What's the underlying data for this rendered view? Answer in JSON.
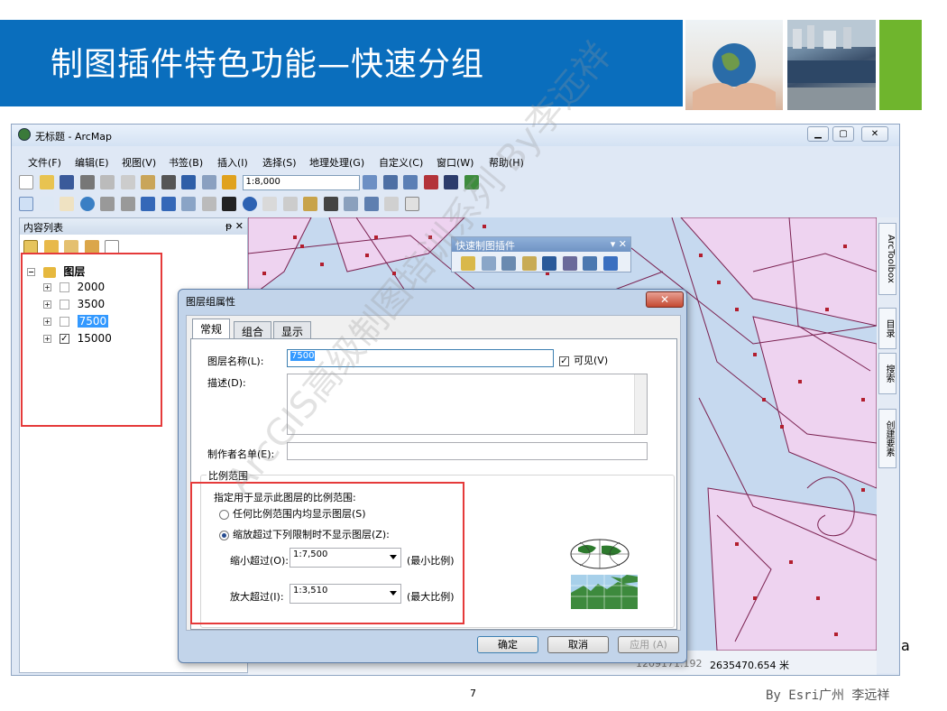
{
  "slide": {
    "title": "制图插件特色功能—快速分组",
    "page_number": "7",
    "footer": "By Esri广州 李远祥",
    "stray_char": "a",
    "watermark": "ArcGIS高级制图培训系列 By李远祥"
  },
  "colors": {
    "header_blue": "#0a6ebd",
    "accent_green": "#6fb52d",
    "highlight_red": "#e53a3a"
  },
  "window": {
    "title": "无标题 - ArcMap",
    "menus": [
      "文件(F)",
      "编辑(E)",
      "视图(V)",
      "书签(B)",
      "插入(I)",
      "选择(S)",
      "地理处理(G)",
      "自定义(C)",
      "窗口(W)",
      "帮助(H)"
    ],
    "scale": "1:8,000"
  },
  "toc": {
    "title": "内容列表",
    "pin": "ᵽ ✕",
    "group": "图层",
    "layers": [
      {
        "name": "2000",
        "checked": false,
        "selected": false
      },
      {
        "name": "3500",
        "checked": false,
        "selected": false
      },
      {
        "name": "7500",
        "checked": false,
        "selected": true
      },
      {
        "name": "15000",
        "checked": true,
        "selected": false
      }
    ]
  },
  "quick_toolbar": {
    "title": "快速制图插件",
    "controls": "▾ ✕"
  },
  "side_tabs": [
    "ArcToolbox",
    "目录",
    "搜索",
    "创建要素"
  ],
  "status": {
    "coords": "2635470.654 米",
    "coords_partial": "1209171.192"
  },
  "dialog": {
    "title": "图层组属性",
    "close": "✕",
    "tabs": [
      "常规",
      "组合",
      "显示"
    ],
    "name_label": "图层名称(L):",
    "name_value": "7500",
    "visible_label": "可见(V)",
    "desc_label": "描述(D):",
    "credits_label": "制作者名单(E):",
    "scale_group": "比例范围",
    "scale_instr": "指定用于显示此图层的比例范围:",
    "opt_any": "任何比例范围内均显示图层(S)",
    "opt_limit": "缩放超过下列限制时不显示图层(Z):",
    "min_label": "缩小超过(O):",
    "min_value": "1:7,500",
    "min_note": "(最小比例)",
    "max_label": "放大超过(I):",
    "max_value": "1:3,510",
    "max_note": "(最大比例)",
    "ok": "确定",
    "cancel": "取消",
    "apply": "应用 (A)"
  }
}
